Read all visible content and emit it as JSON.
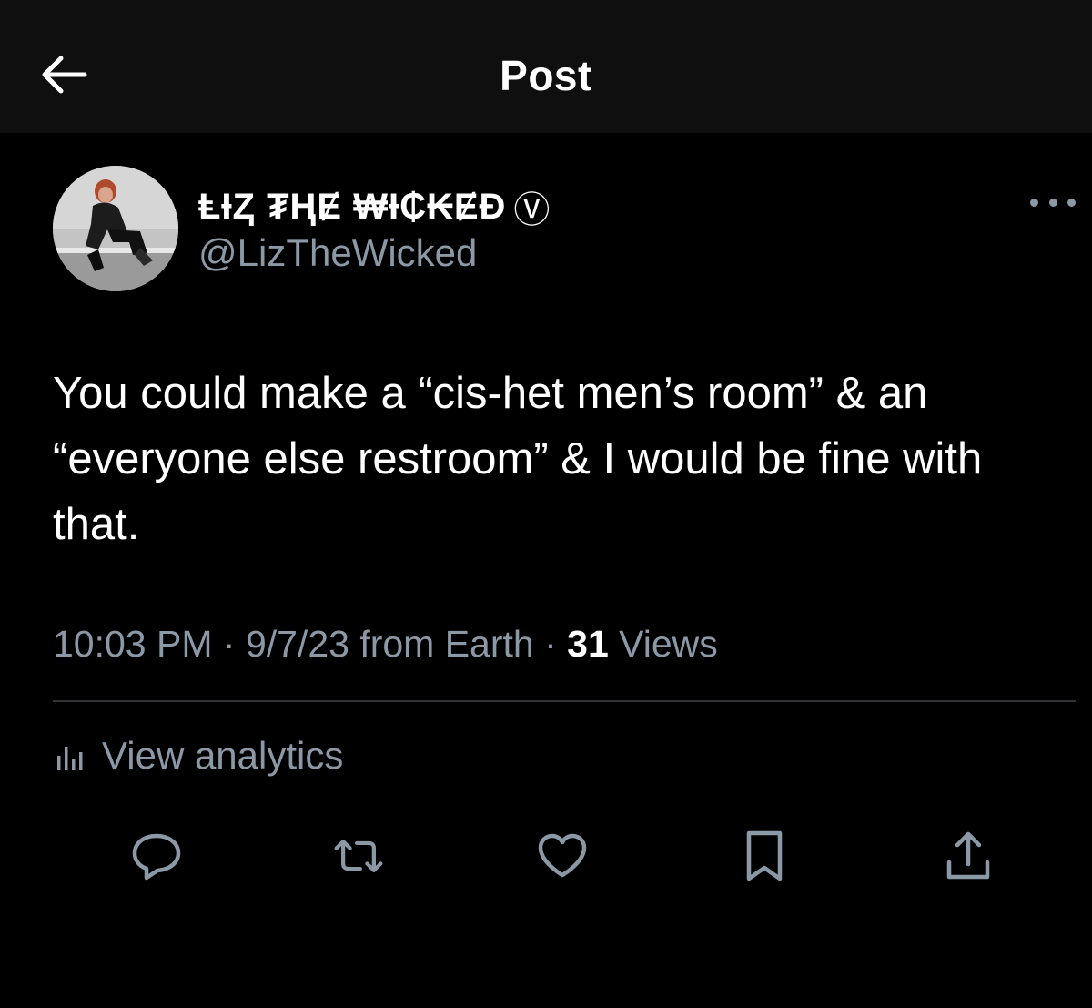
{
  "header": {
    "title": "Post",
    "back_icon": "arrow-left-icon"
  },
  "author": {
    "display_name": "ⱠƗⱫ ₮ⱧɆ ₩Ɨ₵₭ɆĐ",
    "verified_mark": "Ⓥ",
    "handle": "@LizTheWicked",
    "avatar_icon": "avatar-photo"
  },
  "post": {
    "text": "You could make a “cis-het men’s room” & an “everyone else restroom” & I would be fine with that.",
    "time": "10:03 PM",
    "separator1": " · ",
    "date": "9/7/23 from Earth",
    "separator2": " · ",
    "views_count": "31",
    "views_label": " Views"
  },
  "analytics": {
    "label": "View analytics",
    "icon": "bar-chart-icon"
  },
  "actions": [
    {
      "name": "reply",
      "icon": "reply-icon"
    },
    {
      "name": "repost",
      "icon": "repost-icon"
    },
    {
      "name": "like",
      "icon": "heart-icon"
    },
    {
      "name": "bookmark",
      "icon": "bookmark-icon"
    },
    {
      "name": "share",
      "icon": "share-icon"
    }
  ],
  "colors": {
    "background": "#000000",
    "header_bg": "#0f0f0f",
    "primary_text": "#ffffff",
    "secondary_text": "#8b98a5",
    "divider": "#2f3336"
  }
}
